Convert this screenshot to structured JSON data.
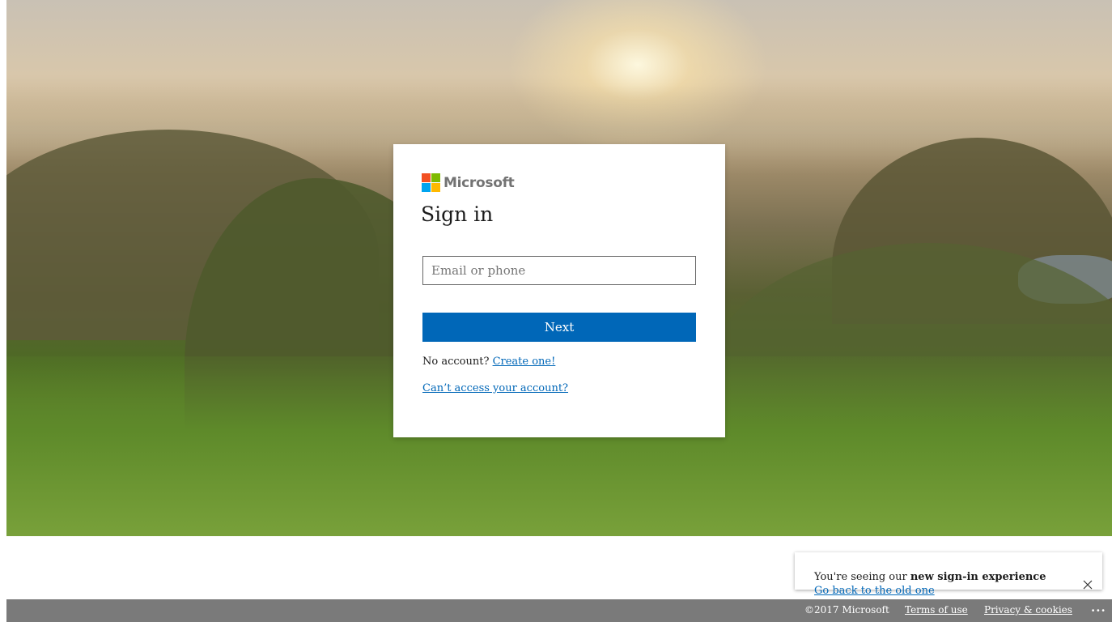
{
  "brand": {
    "name": "Microsoft",
    "logo_colors": [
      "#f25022",
      "#7fba00",
      "#00a4ef",
      "#ffb900"
    ]
  },
  "signin": {
    "title": "Sign in",
    "email_placeholder": "Email or phone",
    "email_value": "",
    "next_label": "Next",
    "no_account_text": "No account?",
    "create_link": "Create one!",
    "cant_access_link": "Can’t access your account?"
  },
  "notification": {
    "prefix": "You're seeing our ",
    "emphasis": "new sign-in experience",
    "old_link": "Go back to the old one"
  },
  "footer": {
    "copyright": "©2017 Microsoft",
    "terms": "Terms of use",
    "privacy": "Privacy & cookies",
    "more": "..."
  },
  "icons": {
    "close": "close-icon",
    "more": "more-icon"
  },
  "colors": {
    "accent": "#0067b8",
    "footer_bg": "#7a7a7a"
  }
}
